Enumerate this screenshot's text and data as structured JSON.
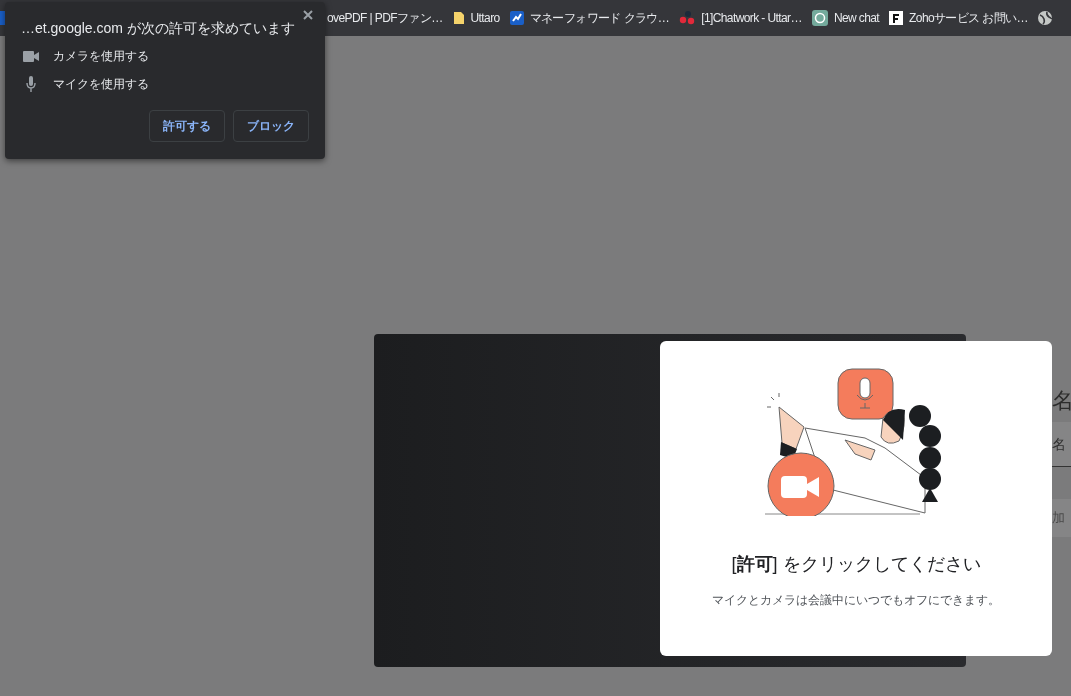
{
  "bookmarks": [
    {
      "label": "ovePDF | PDFファン…"
    },
    {
      "label": "Uttaro"
    },
    {
      "label": "マネーフォワード クラウ…"
    },
    {
      "label": "[1]Chatwork - Uttar…"
    },
    {
      "label": "New chat"
    },
    {
      "label": "Zohoサービス お問い…"
    }
  ],
  "permission_popup": {
    "title": "…et.google.com が次の許可を求めています",
    "permissions": [
      {
        "label": "カメラを使用する",
        "kind": "camera"
      },
      {
        "label": "マイクを使用する",
        "kind": "mic"
      }
    ],
    "buttons": [
      "許可する",
      "ブロック"
    ]
  },
  "permission_card": {
    "heading": "[**許可**] をクリックしてください",
    "note": "マイクとカメラは会議中にいつでもオフにできます。"
  },
  "side_panel": {
    "heading": "名",
    "name_field": {
      "placeholder": "名"
    },
    "button": "加"
  }
}
